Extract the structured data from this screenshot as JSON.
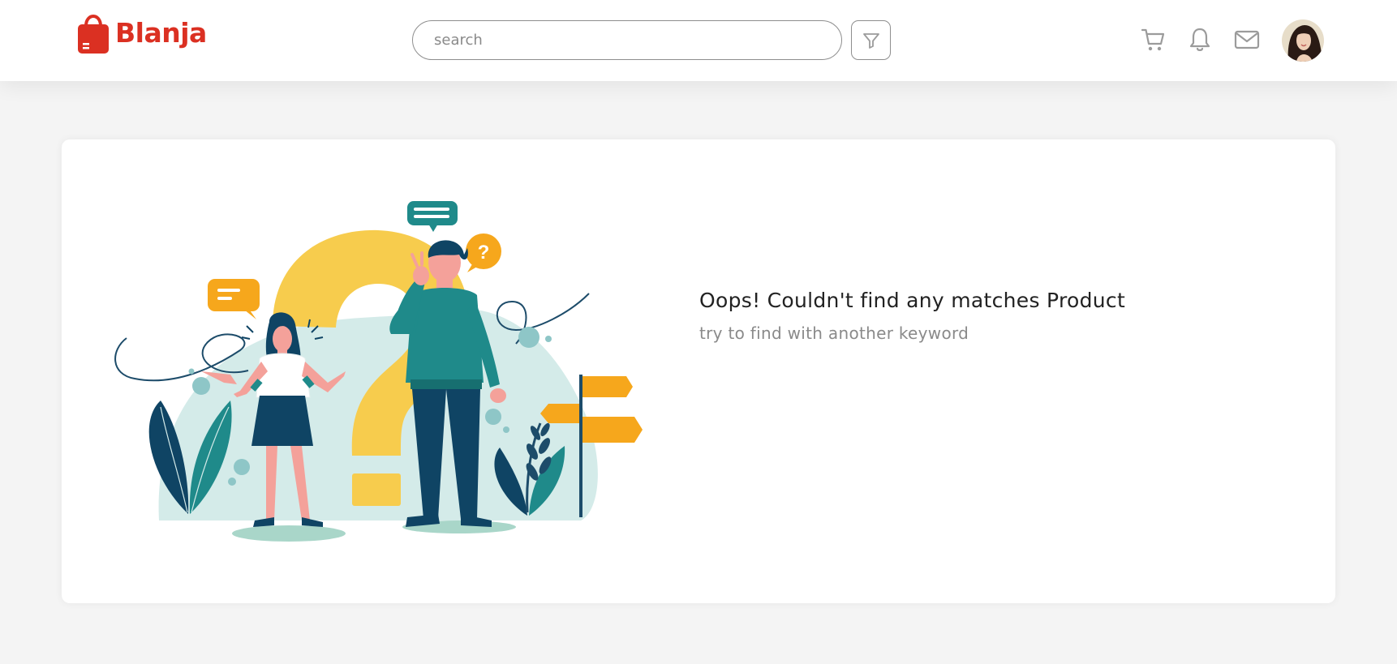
{
  "brand": {
    "name": "Blanja",
    "color": "#db3022"
  },
  "search": {
    "placeholder": "search",
    "value": ""
  },
  "header_icons": [
    "funnel-icon",
    "cart-icon",
    "bell-icon",
    "mail-icon"
  ],
  "user": {
    "avatar": "avatar"
  },
  "empty_state": {
    "title": "Oops! Couldn't find any matches Product",
    "subtitle": "try to find with another keyword"
  },
  "colors": {
    "page_bg": "#f4f4f4",
    "card_bg": "#ffffff",
    "illustration_yellow": "#f7cc4d",
    "illustration_teal": "#1f8a8a",
    "illustration_navy": "#0f4464",
    "illustration_orange": "#f6a71c",
    "illustration_mint": "#d4ebe9"
  }
}
